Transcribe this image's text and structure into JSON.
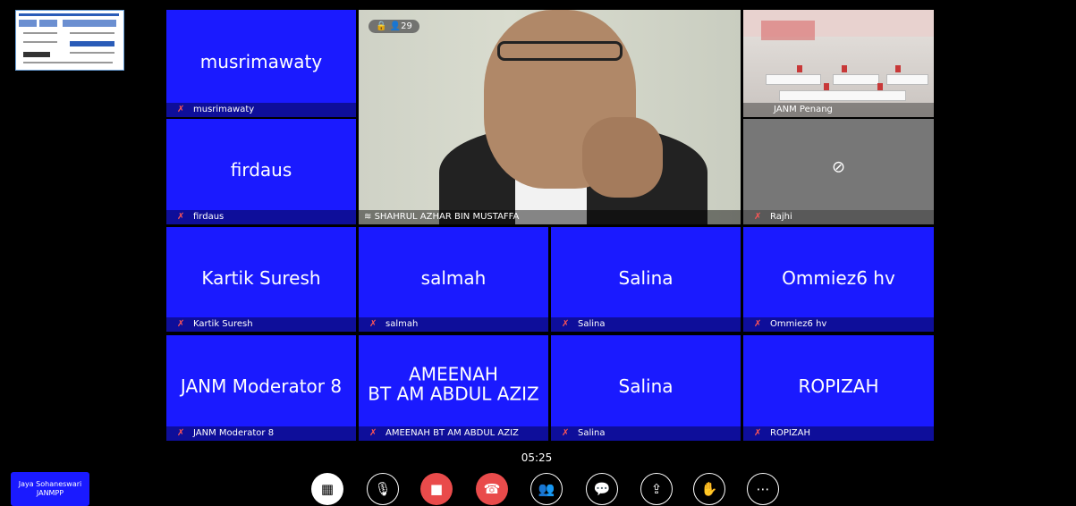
{
  "meeting": {
    "participant_count": "29",
    "timer": "05:25",
    "self_tile": {
      "line1": "Jaya Sohaneswari",
      "line2": "JANMPP"
    }
  },
  "featured": {
    "speaker_label": "SHAHRUL AZHAR BIN MUSTAFFA",
    "room_label": "JANM Penang",
    "camoff_label": "Rajhi"
  },
  "tiles": [
    {
      "display": "musrimawaty",
      "label": "musrimawaty"
    },
    {
      "display": "firdaus",
      "label": "firdaus"
    },
    {
      "display": "Kartik Suresh",
      "label": "Kartik Suresh"
    },
    {
      "display": "salmah",
      "label": "salmah"
    },
    {
      "display": "Salina",
      "label": "Salina"
    },
    {
      "display": "Ommiez6 hv",
      "label": "Ommiez6 hv"
    },
    {
      "display": "JANM Moderator 8",
      "label": "JANM Moderator 8"
    },
    {
      "display": "AMEENAH\nBT AM ABDUL AZIZ",
      "label": "AMEENAH BT AM ABDUL AZIZ"
    },
    {
      "display": "Salina",
      "label": "Salina"
    },
    {
      "display": "ROPIZAH",
      "label": "ROPIZAH"
    }
  ],
  "controls": [
    {
      "name": "layout-icon",
      "glyph": "▦"
    },
    {
      "name": "mic-muted-icon",
      "glyph": "🎙"
    },
    {
      "name": "camera-off-icon",
      "glyph": "■"
    },
    {
      "name": "hangup-icon",
      "glyph": "☎"
    },
    {
      "name": "participants-icon",
      "glyph": "👥"
    },
    {
      "name": "chat-icon",
      "glyph": "💬"
    },
    {
      "name": "share-screen-icon",
      "glyph": "⇪"
    },
    {
      "name": "raise-hand-icon",
      "glyph": "✋"
    },
    {
      "name": "more-icon",
      "glyph": "⋯"
    }
  ],
  "colors": {
    "tile": "#1a1aff",
    "hangup": "#e94b4b",
    "camera_off": "#e94b4b"
  }
}
